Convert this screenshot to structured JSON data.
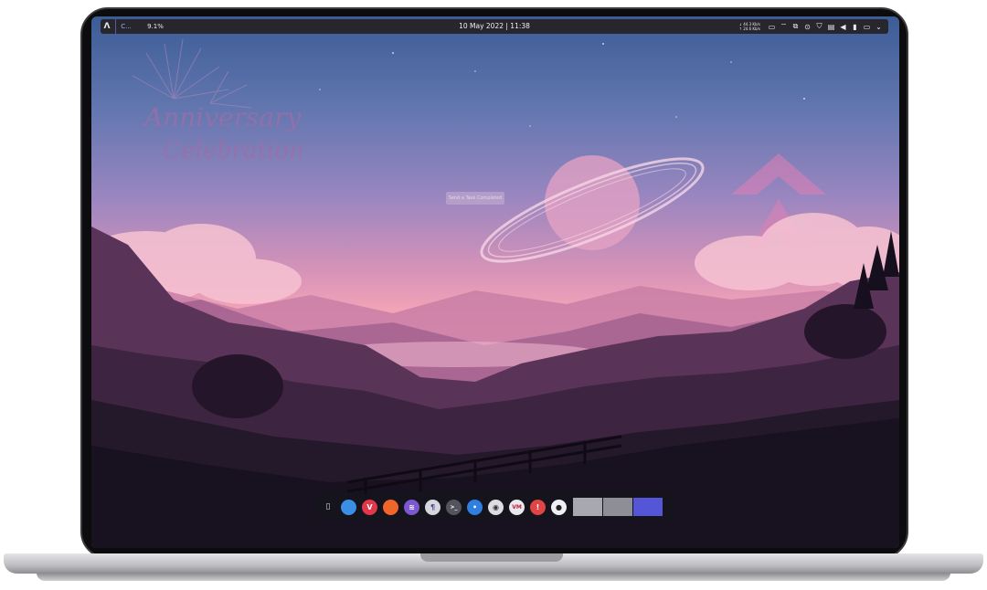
{
  "panel": {
    "launcher_icon": "arch-logo-icon",
    "active_window_label": "C...",
    "cpu_usage": "9.1%",
    "clock": "10 May 2022 | 11:38",
    "net_down": "44.3 Kb/s",
    "net_up": "24.6 Kb/s",
    "tray_icons": [
      "clipboard-icon",
      "wifi-icon",
      "screens-icon",
      "record-icon",
      "shield-icon",
      "clipboard-list-icon",
      "volume-icon",
      "battery-icon",
      "display-icon",
      "chevron-down-icon"
    ]
  },
  "wallpaper": {
    "watermark_line1": "Anniversary",
    "watermark_line2": "Celebration",
    "tooltip": "Send a Task Completed"
  },
  "dock": {
    "items": [
      {
        "name": "overview-icon",
        "glyph": "▯▯",
        "color": "#2a2a33"
      },
      {
        "name": "browser-icon",
        "glyph": "",
        "color": "#3b8ee6"
      },
      {
        "name": "vivaldi-icon",
        "glyph": "V",
        "color": "#e0384a"
      },
      {
        "name": "firefox-icon",
        "glyph": "",
        "color": "#f0652a"
      },
      {
        "name": "network-app-icon",
        "glyph": "≋",
        "color": "#7d57d0"
      },
      {
        "name": "python-icon",
        "glyph": "¶",
        "color": "#d6d6df"
      },
      {
        "name": "terminal-icon",
        "glyph": ">_",
        "color": "#54545e"
      },
      {
        "name": "discord-app-icon",
        "glyph": "•",
        "color": "#2f7fe0"
      },
      {
        "name": "media-player-icon",
        "glyph": "◉",
        "color": "#dcdce2"
      },
      {
        "name": "vm-app-icon",
        "glyph": "VM",
        "color": "#e8e8ee"
      },
      {
        "name": "settings-app-icon",
        "glyph": "!",
        "color": "#e04444"
      },
      {
        "name": "record-app-icon",
        "glyph": "●",
        "color": "#f0f0f4"
      }
    ],
    "workspaces": [
      {
        "name": "workspace-1",
        "color": "#a8a8b0",
        "active": false
      },
      {
        "name": "workspace-2",
        "color": "#8e8e96",
        "active": false
      },
      {
        "name": "workspace-3",
        "color": "#5555d8",
        "active": true
      }
    ]
  }
}
